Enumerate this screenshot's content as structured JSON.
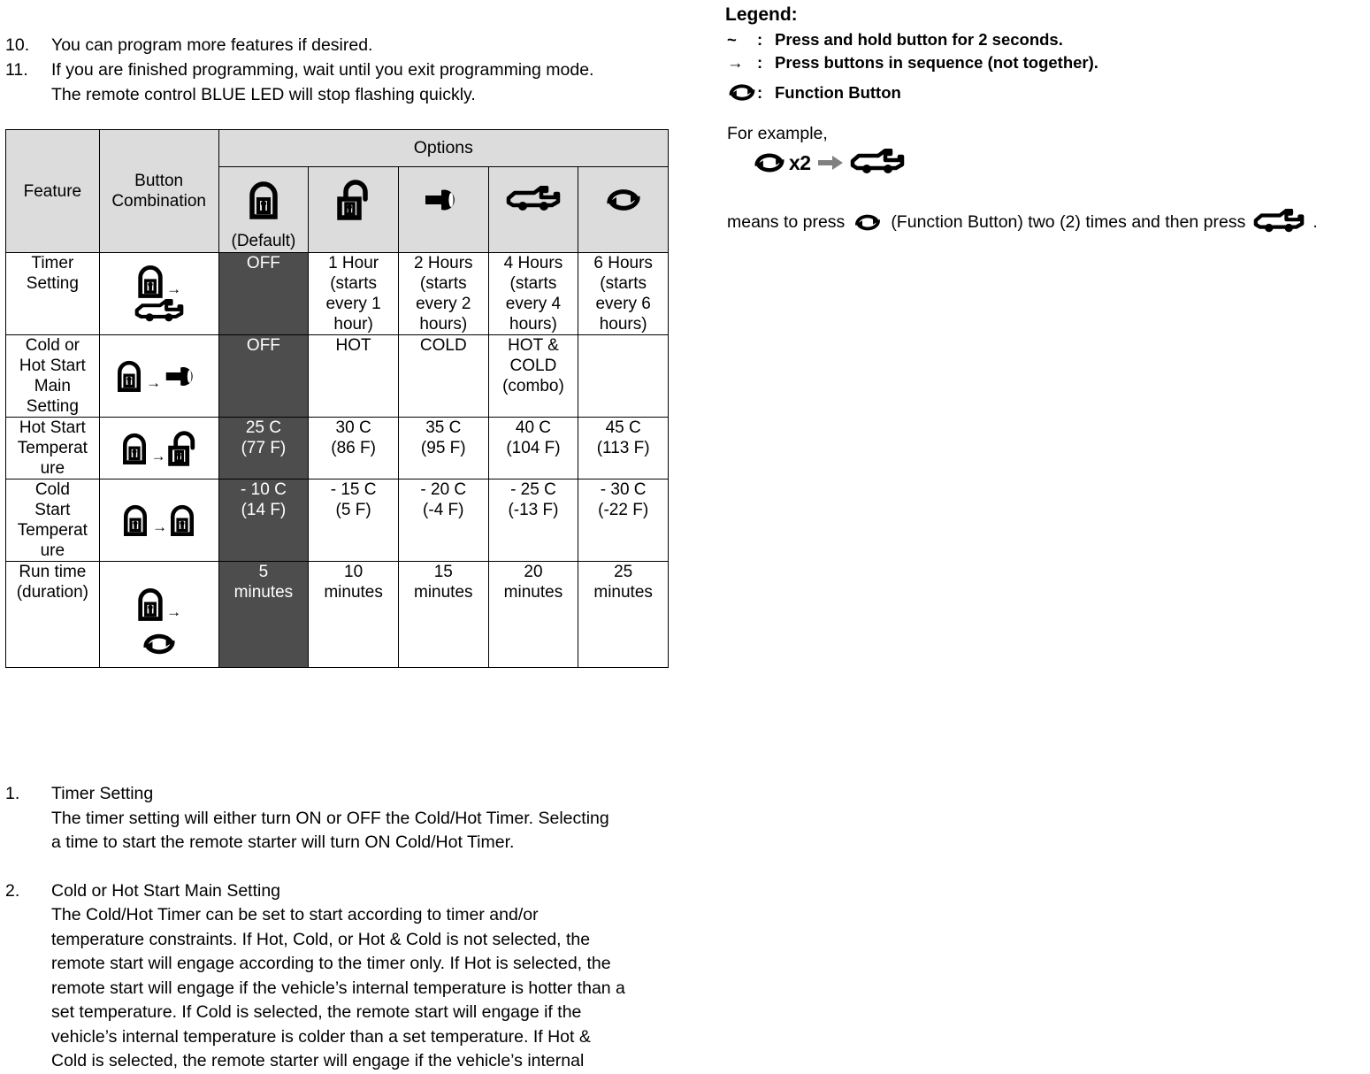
{
  "document": {
    "top_steps": [
      {
        "num": "10.",
        "lines": [
          "You can program more features if desired."
        ]
      },
      {
        "num": "11.",
        "lines": [
          "If you are finished programming, wait until you exit programming mode.",
          "The remote control BLUE LED will stop flashing quickly."
        ]
      }
    ],
    "bottom_steps": [
      {
        "num": "1.",
        "title": "Timer Setting",
        "lines": [
          "The timer setting will either turn ON or OFF the Cold/Hot Timer.  Selecting",
          "a time to start the remote starter will turn ON  Cold/Hot Timer."
        ]
      },
      {
        "num": "2.",
        "title": "Cold or Hot Start Main Setting",
        "lines": [
          "The Cold/Hot Timer can be set to start according to timer and/or",
          "temperature constraints.  If Hot, Cold, or Hot & Cold is not selected, the",
          "remote start will engage according to the timer only.  If Hot is selected, the",
          "remote start will engage if the vehicle’s internal temperature is hotter than a",
          "set temperature.  If Cold is selected, the remote start will engage if the",
          "vehicle’s internal temperature is colder than a set temperature.  If Hot &",
          "Cold is selected, the remote starter will engage if the vehicle’s internal"
        ]
      }
    ]
  },
  "table": {
    "headers": {
      "feature": "Feature",
      "button_combination": "Button Combination",
      "options": "Options",
      "default_label": "(Default)",
      "option_icons": [
        "lock-icon",
        "unlock-icon",
        "key-icon",
        "car-icon",
        "function-button-icon"
      ]
    },
    "rows": [
      {
        "feature": "Timer Setting",
        "combo": {
          "layout": "stack",
          "icons": [
            "lock-icon",
            "car-icon"
          ],
          "separator": "→"
        },
        "options": [
          "OFF",
          "1 Hour (starts every 1 hour)",
          "2 Hours (starts every 2 hours)",
          "4 Hours (starts every 4 hours)",
          "6 Hours (starts every 6 hours)"
        ]
      },
      {
        "feature": "Cold or Hot Start Main Setting",
        "combo": {
          "layout": "inline",
          "icons": [
            "lock-icon",
            "key-icon"
          ],
          "separator": "→"
        },
        "options": [
          "OFF",
          "HOT",
          "COLD",
          "HOT & COLD (combo)",
          ""
        ]
      },
      {
        "feature": "Hot Start Temperature",
        "combo": {
          "layout": "inline",
          "icons": [
            "lock-icon",
            "unlock-icon"
          ],
          "separator": "→"
        },
        "options": [
          "25 C (77 F)",
          "30 C (86 F)",
          "35 C (95 F)",
          "40 C (104 F)",
          "45 C (113 F)"
        ]
      },
      {
        "feature": "Cold Start Temperature",
        "combo": {
          "layout": "inline",
          "icons": [
            "lock-icon",
            "lock-icon"
          ],
          "separator": "→"
        },
        "options": [
          "- 10 C (14 F)",
          "- 15 C (5 F)",
          "- 20 C (-4 F)",
          "- 25 C (-13 F)",
          "- 30 C (-22 F)"
        ]
      },
      {
        "feature": "Run time (duration)",
        "combo": {
          "layout": "stack",
          "icons": [
            "lock-icon",
            "function-button-icon"
          ],
          "separator": "→"
        },
        "options": [
          "5 minutes",
          "10 minutes",
          "15 minutes",
          "20 minutes",
          "25 minutes"
        ]
      }
    ],
    "cells": {
      "r0": {
        "feature_l1": "Timer",
        "feature_l2": "Setting",
        "o0": "OFF",
        "o1_l1": "1 Hour",
        "o1_l2": "(starts",
        "o1_l3": "every 1",
        "o1_l4": "hour)",
        "o2_l1": "2 Hours",
        "o2_l2": "(starts",
        "o2_l3": "every 2",
        "o2_l4": "hours)",
        "o3_l1": "4 Hours",
        "o3_l2": "(starts",
        "o3_l3": "every 4",
        "o3_l4": "hours)",
        "o4_l1": "6 Hours",
        "o4_l2": "(starts",
        "o4_l3": "every 6",
        "o4_l4": "hours)"
      },
      "r1": {
        "feature_l1": "Cold or",
        "feature_l2": "Hot Start",
        "feature_l3": "Main",
        "feature_l4": "Setting",
        "o0": "OFF",
        "o1": "HOT",
        "o2": "COLD",
        "o3_l1": "HOT &",
        "o3_l2": "COLD",
        "o3_l3": "(combo)",
        "o4": ""
      },
      "r2": {
        "feature_l1": "Hot Start",
        "feature_l2": "Temperat",
        "feature_l3": "ure",
        "o0_l1": "25 C",
        "o0_l2": "(77 F)",
        "o1_l1": "30 C",
        "o1_l2": "(86 F)",
        "o2_l1": "35 C",
        "o2_l2": "(95 F)",
        "o3_l1": "40 C",
        "o3_l2": "(104 F)",
        "o4_l1": "45 C",
        "o4_l2": "(113 F)"
      },
      "r3": {
        "feature_l1": "Cold",
        "feature_l2": "Start",
        "feature_l3": "Temperat",
        "feature_l4": "ure",
        "o0_l1": "- 10 C",
        "o0_l2": "(14 F)",
        "o1_l1": "- 15 C",
        "o1_l2": "(5 F)",
        "o2_l1": "- 20 C",
        "o2_l2": "(-4 F)",
        "o3_l1": "- 25 C",
        "o3_l2": "(-13 F)",
        "o4_l1": "- 30 C",
        "o4_l2": "(-22 F)"
      },
      "r4": {
        "feature_l1": "Run time",
        "feature_l2": "(duration)",
        "o0_l1": "5",
        "o0_l2": "minutes",
        "o1_l1": "10",
        "o1_l2": "minutes",
        "o2_l1": "15",
        "o2_l2": "minutes",
        "o3_l1": "20",
        "o3_l2": "minutes",
        "o4_l1": "25",
        "o4_l2": "minutes"
      }
    }
  },
  "legend": {
    "title": "Legend:",
    "entries": [
      {
        "symbol": "~",
        "colon": ":",
        "text": "Press and hold button for 2 seconds."
      },
      {
        "symbol": "→",
        "colon": ":",
        "text": "Press buttons in sequence (not together)."
      },
      {
        "symbol": "function-button-icon",
        "colon": ":",
        "text": "Function Button"
      }
    ],
    "for_example": "For example,",
    "example": {
      "multiplier": "x2",
      "first_icon": "function-button-icon",
      "arrow": "arrow-right-icon",
      "second_icon": "car-icon"
    },
    "means": {
      "part1": "means to press",
      "part2": "(Function Button) two (2) times and then press",
      "part3": "."
    }
  },
  "colors": {
    "header_bg": "#dcdcdc",
    "default_cell_bg": "#4d4d4d",
    "default_cell_text": "#ffffff",
    "border": "#000000",
    "page_bg": "#ffffff",
    "example_arrow": "#808080"
  }
}
